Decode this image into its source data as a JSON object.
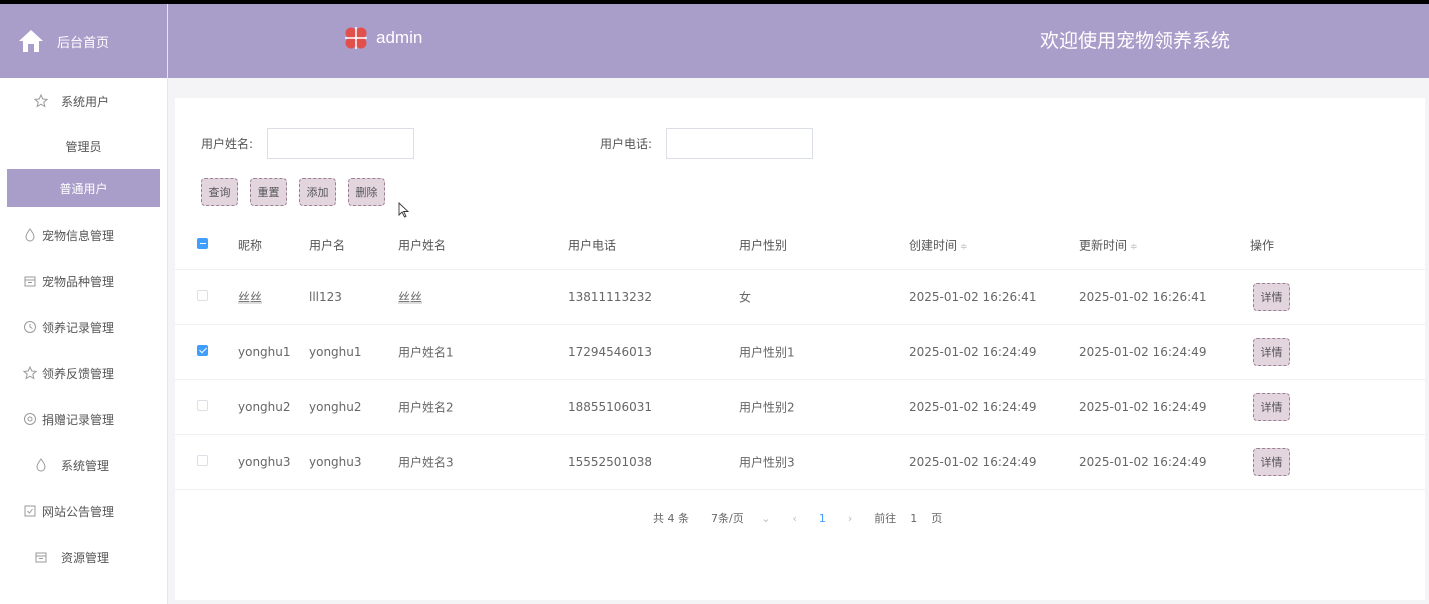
{
  "sidebar": {
    "home_label": "后台首页",
    "menus": [
      {
        "label": "系统用户",
        "icon": "star-icon"
      },
      {
        "label": "宠物信息管理",
        "icon": "drop-icon"
      },
      {
        "label": "宠物品种管理",
        "icon": "box-icon"
      },
      {
        "label": "领养记录管理",
        "icon": "clock-icon"
      },
      {
        "label": "领养反馈管理",
        "icon": "star-icon"
      },
      {
        "label": "捐赠记录管理",
        "icon": "circle-icon"
      },
      {
        "label": "系统管理",
        "icon": "drop-icon"
      },
      {
        "label": "网站公告管理",
        "icon": "check-square-icon"
      },
      {
        "label": "资源管理",
        "icon": "box-icon"
      }
    ],
    "sub_items": [
      "管理员",
      "普通用户"
    ],
    "active_sub": "普通用户"
  },
  "topbar": {
    "brand": "admin",
    "welcome": "欢迎使用宠物领养系统"
  },
  "search": {
    "name_label": "用户姓名:",
    "phone_label": "用户电话:",
    "name_value": "",
    "phone_value": ""
  },
  "buttons": {
    "query": "查询",
    "reset": "重置",
    "add": "添加",
    "delete": "删除"
  },
  "table": {
    "headers": [
      "昵称",
      "用户名",
      "用户姓名",
      "用户电话",
      "用户性别",
      "创建时间",
      "更新时间",
      "操作"
    ],
    "sort_glyph": "≑",
    "rows": [
      {
        "checked": false,
        "nickname": "丝丝",
        "username": "lll123",
        "realname": "丝丝",
        "phone": "13811113232",
        "gender": "女",
        "created": "2025-01-02 16:26:41",
        "updated": "2025-01-02 16:26:41",
        "action": "详情"
      },
      {
        "checked": true,
        "nickname": "yonghu1",
        "username": "yonghu1",
        "realname": "用户姓名1",
        "phone": "17294546013",
        "gender": "用户性别1",
        "created": "2025-01-02 16:24:49",
        "updated": "2025-01-02 16:24:49",
        "action": "详情"
      },
      {
        "checked": false,
        "nickname": "yonghu2",
        "username": "yonghu2",
        "realname": "用户姓名2",
        "phone": "18855106031",
        "gender": "用户性别2",
        "created": "2025-01-02 16:24:49",
        "updated": "2025-01-02 16:24:49",
        "action": "详情"
      },
      {
        "checked": false,
        "nickname": "yonghu3",
        "username": "yonghu3",
        "realname": "用户姓名3",
        "phone": "15552501038",
        "gender": "用户性别3",
        "created": "2025-01-02 16:24:49",
        "updated": "2025-01-02 16:24:49",
        "action": "详情"
      }
    ]
  },
  "pagination": {
    "total": "共 4 条",
    "page_size": "7条/页",
    "prev": "‹",
    "current": "1",
    "next": "›",
    "goto_label": "前往",
    "goto_value": "1",
    "page_suffix": "页",
    "dropdown": "⌄"
  },
  "colors": {
    "accent": "#a99dca",
    "button_bg": "#e3d5de",
    "checkbox": "#409eff"
  }
}
